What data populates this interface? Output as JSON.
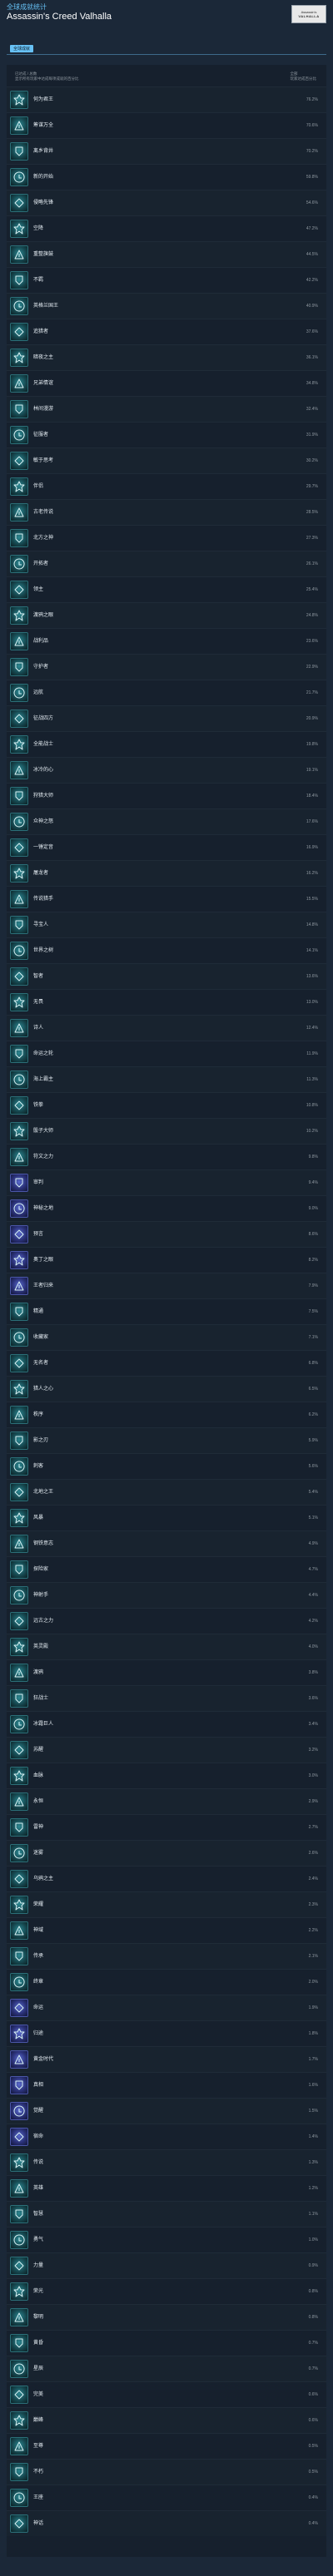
{
  "header": {
    "subtitle": "全球成就统计",
    "title": "Assassin's Creed Valhalla",
    "logo_line1": "Assassin's",
    "logo_line2": "VALHALLA"
  },
  "tabs": [
    {
      "label": "全球成就"
    }
  ],
  "summary": {
    "left_line1": "已达成 / 总数",
    "left_line2": "显示所有玩家中达成每项成就的百分比",
    "right_line1": "全部",
    "right_line2": "玩家达成百分比"
  },
  "achievements": [
    {
      "name": "何为君王",
      "desc": "",
      "pct": "76.2%",
      "style": "teal"
    },
    {
      "name": "筹谋万全",
      "desc": "",
      "pct": "70.6%",
      "style": "teal"
    },
    {
      "name": "离乡背井",
      "desc": "",
      "pct": "70.2%",
      "style": "teal"
    },
    {
      "name": "新的开始",
      "desc": "",
      "pct": "59.8%",
      "style": "teal"
    },
    {
      "name": "侵略先锋",
      "desc": "",
      "pct": "54.6%",
      "style": "teal"
    },
    {
      "name": "空降",
      "desc": "",
      "pct": "47.2%",
      "style": "teal"
    },
    {
      "name": "重整旗鼓",
      "desc": "",
      "pct": "44.5%",
      "style": "teal"
    },
    {
      "name": "不羁",
      "desc": "",
      "pct": "42.2%",
      "style": "teal"
    },
    {
      "name": "英格兰国王",
      "desc": "",
      "pct": "40.9%",
      "style": "teal"
    },
    {
      "name": "追猎者",
      "desc": "",
      "pct": "37.6%",
      "style": "teal"
    },
    {
      "name": "暗夜之主",
      "desc": "",
      "pct": "36.1%",
      "style": "teal"
    },
    {
      "name": "兄弟情谊",
      "desc": "",
      "pct": "34.8%",
      "style": "teal"
    },
    {
      "name": "林间漫游",
      "desc": "",
      "pct": "32.4%",
      "style": "teal"
    },
    {
      "name": "征服者",
      "desc": "",
      "pct": "31.9%",
      "style": "teal"
    },
    {
      "name": "敏于思考",
      "desc": "",
      "pct": "30.2%",
      "style": "teal"
    },
    {
      "name": "伴侣",
      "desc": "",
      "pct": "29.7%",
      "style": "teal"
    },
    {
      "name": "古老传说",
      "desc": "",
      "pct": "28.5%",
      "style": "teal"
    },
    {
      "name": "北方之神",
      "desc": "",
      "pct": "27.3%",
      "style": "teal"
    },
    {
      "name": "开拓者",
      "desc": "",
      "pct": "26.1%",
      "style": "teal"
    },
    {
      "name": "领主",
      "desc": "",
      "pct": "25.4%",
      "style": "teal"
    },
    {
      "name": "渡鸦之眼",
      "desc": "",
      "pct": "24.8%",
      "style": "teal"
    },
    {
      "name": "战利品",
      "desc": "",
      "pct": "23.6%",
      "style": "teal"
    },
    {
      "name": "守护者",
      "desc": "",
      "pct": "22.9%",
      "style": "teal"
    },
    {
      "name": "远航",
      "desc": "",
      "pct": "21.7%",
      "style": "teal"
    },
    {
      "name": "征战四方",
      "desc": "",
      "pct": "20.9%",
      "style": "teal"
    },
    {
      "name": "全能战士",
      "desc": "",
      "pct": "19.8%",
      "style": "teal"
    },
    {
      "name": "冰冷的心",
      "desc": "",
      "pct": "19.1%",
      "style": "teal"
    },
    {
      "name": "狩猎大师",
      "desc": "",
      "pct": "18.4%",
      "style": "teal"
    },
    {
      "name": "众神之怒",
      "desc": "",
      "pct": "17.6%",
      "style": "teal"
    },
    {
      "name": "一锤定音",
      "desc": "",
      "pct": "16.9%",
      "style": "teal"
    },
    {
      "name": "屠龙者",
      "desc": "",
      "pct": "16.2%",
      "style": "teal"
    },
    {
      "name": "传说猎手",
      "desc": "",
      "pct": "15.5%",
      "style": "teal"
    },
    {
      "name": "寻宝人",
      "desc": "",
      "pct": "14.8%",
      "style": "teal"
    },
    {
      "name": "世界之树",
      "desc": "",
      "pct": "14.1%",
      "style": "teal"
    },
    {
      "name": "智者",
      "desc": "",
      "pct": "13.6%",
      "style": "teal"
    },
    {
      "name": "无畏",
      "desc": "",
      "pct": "13.0%",
      "style": "teal"
    },
    {
      "name": "诗人",
      "desc": "",
      "pct": "12.4%",
      "style": "teal"
    },
    {
      "name": "命运之轮",
      "desc": "",
      "pct": "11.9%",
      "style": "teal"
    },
    {
      "name": "海上霸主",
      "desc": "",
      "pct": "11.3%",
      "style": "teal"
    },
    {
      "name": "铁拳",
      "desc": "",
      "pct": "10.8%",
      "style": "teal"
    },
    {
      "name": "骰子大师",
      "desc": "",
      "pct": "10.2%",
      "style": "teal"
    },
    {
      "name": "符文之力",
      "desc": "",
      "pct": "9.8%",
      "style": "teal"
    },
    {
      "name": "审判",
      "desc": "",
      "pct": "9.4%",
      "style": "blue"
    },
    {
      "name": "神秘之地",
      "desc": "",
      "pct": "9.0%",
      "style": "blue"
    },
    {
      "name": "预言",
      "desc": "",
      "pct": "8.6%",
      "style": "blue"
    },
    {
      "name": "奥丁之眼",
      "desc": "",
      "pct": "8.2%",
      "style": "blue"
    },
    {
      "name": "王者归来",
      "desc": "",
      "pct": "7.9%",
      "style": "blue"
    },
    {
      "name": "精通",
      "desc": "",
      "pct": "7.5%",
      "style": "teal"
    },
    {
      "name": "收藏家",
      "desc": "",
      "pct": "7.1%",
      "style": "teal"
    },
    {
      "name": "无名者",
      "desc": "",
      "pct": "6.8%",
      "style": "teal"
    },
    {
      "name": "猎人之心",
      "desc": "",
      "pct": "6.5%",
      "style": "teal"
    },
    {
      "name": "秩序",
      "desc": "",
      "pct": "6.2%",
      "style": "teal"
    },
    {
      "name": "影之刃",
      "desc": "",
      "pct": "5.9%",
      "style": "teal"
    },
    {
      "name": "刺客",
      "desc": "",
      "pct": "5.6%",
      "style": "teal"
    },
    {
      "name": "北地之王",
      "desc": "",
      "pct": "5.4%",
      "style": "teal"
    },
    {
      "name": "风暴",
      "desc": "",
      "pct": "5.1%",
      "style": "teal"
    },
    {
      "name": "钢铁意志",
      "desc": "",
      "pct": "4.9%",
      "style": "teal"
    },
    {
      "name": "探险家",
      "desc": "",
      "pct": "4.7%",
      "style": "teal"
    },
    {
      "name": "神射手",
      "desc": "",
      "pct": "4.4%",
      "style": "teal"
    },
    {
      "name": "远古之力",
      "desc": "",
      "pct": "4.2%",
      "style": "teal"
    },
    {
      "name": "英灵殿",
      "desc": "",
      "pct": "4.0%",
      "style": "teal"
    },
    {
      "name": "渡鸦",
      "desc": "",
      "pct": "3.8%",
      "style": "teal"
    },
    {
      "name": "狂战士",
      "desc": "",
      "pct": "3.6%",
      "style": "teal"
    },
    {
      "name": "冰霜巨人",
      "desc": "",
      "pct": "3.4%",
      "style": "teal"
    },
    {
      "name": "苏醒",
      "desc": "",
      "pct": "3.2%",
      "style": "teal"
    },
    {
      "name": "血脉",
      "desc": "",
      "pct": "3.0%",
      "style": "teal"
    },
    {
      "name": "永恒",
      "desc": "",
      "pct": "2.9%",
      "style": "teal"
    },
    {
      "name": "雷神",
      "desc": "",
      "pct": "2.7%",
      "style": "teal"
    },
    {
      "name": "迷雾",
      "desc": "",
      "pct": "2.6%",
      "style": "teal"
    },
    {
      "name": "乌鸦之主",
      "desc": "",
      "pct": "2.4%",
      "style": "teal"
    },
    {
      "name": "荣耀",
      "desc": "",
      "pct": "2.3%",
      "style": "teal"
    },
    {
      "name": "神域",
      "desc": "",
      "pct": "2.2%",
      "style": "teal"
    },
    {
      "name": "传承",
      "desc": "",
      "pct": "2.1%",
      "style": "teal"
    },
    {
      "name": "终章",
      "desc": "",
      "pct": "2.0%",
      "style": "teal"
    },
    {
      "name": "命运",
      "desc": "",
      "pct": "1.9%",
      "style": "blue"
    },
    {
      "name": "归途",
      "desc": "",
      "pct": "1.8%",
      "style": "blue"
    },
    {
      "name": "黄金时代",
      "desc": "",
      "pct": "1.7%",
      "style": "blue"
    },
    {
      "name": "真相",
      "desc": "",
      "pct": "1.6%",
      "style": "blue"
    },
    {
      "name": "觉醒",
      "desc": "",
      "pct": "1.5%",
      "style": "blue"
    },
    {
      "name": "宿命",
      "desc": "",
      "pct": "1.4%",
      "style": "blue"
    },
    {
      "name": "传说",
      "desc": "",
      "pct": "1.3%",
      "style": "teal"
    },
    {
      "name": "英雄",
      "desc": "",
      "pct": "1.2%",
      "style": "teal"
    },
    {
      "name": "智慧",
      "desc": "",
      "pct": "1.1%",
      "style": "teal"
    },
    {
      "name": "勇气",
      "desc": "",
      "pct": "1.0%",
      "style": "teal"
    },
    {
      "name": "力量",
      "desc": "",
      "pct": "0.9%",
      "style": "teal"
    },
    {
      "name": "荣光",
      "desc": "",
      "pct": "0.8%",
      "style": "teal"
    },
    {
      "name": "黎明",
      "desc": "",
      "pct": "0.8%",
      "style": "teal"
    },
    {
      "name": "黄昏",
      "desc": "",
      "pct": "0.7%",
      "style": "teal"
    },
    {
      "name": "星辰",
      "desc": "",
      "pct": "0.7%",
      "style": "teal"
    },
    {
      "name": "完美",
      "desc": "",
      "pct": "0.6%",
      "style": "teal"
    },
    {
      "name": "巅峰",
      "desc": "",
      "pct": "0.6%",
      "style": "teal"
    },
    {
      "name": "至尊",
      "desc": "",
      "pct": "0.5%",
      "style": "teal"
    },
    {
      "name": "不朽",
      "desc": "",
      "pct": "0.5%",
      "style": "teal"
    },
    {
      "name": "王座",
      "desc": "",
      "pct": "0.4%",
      "style": "teal"
    },
    {
      "name": "神话",
      "desc": "",
      "pct": "0.4%",
      "style": "teal"
    }
  ]
}
